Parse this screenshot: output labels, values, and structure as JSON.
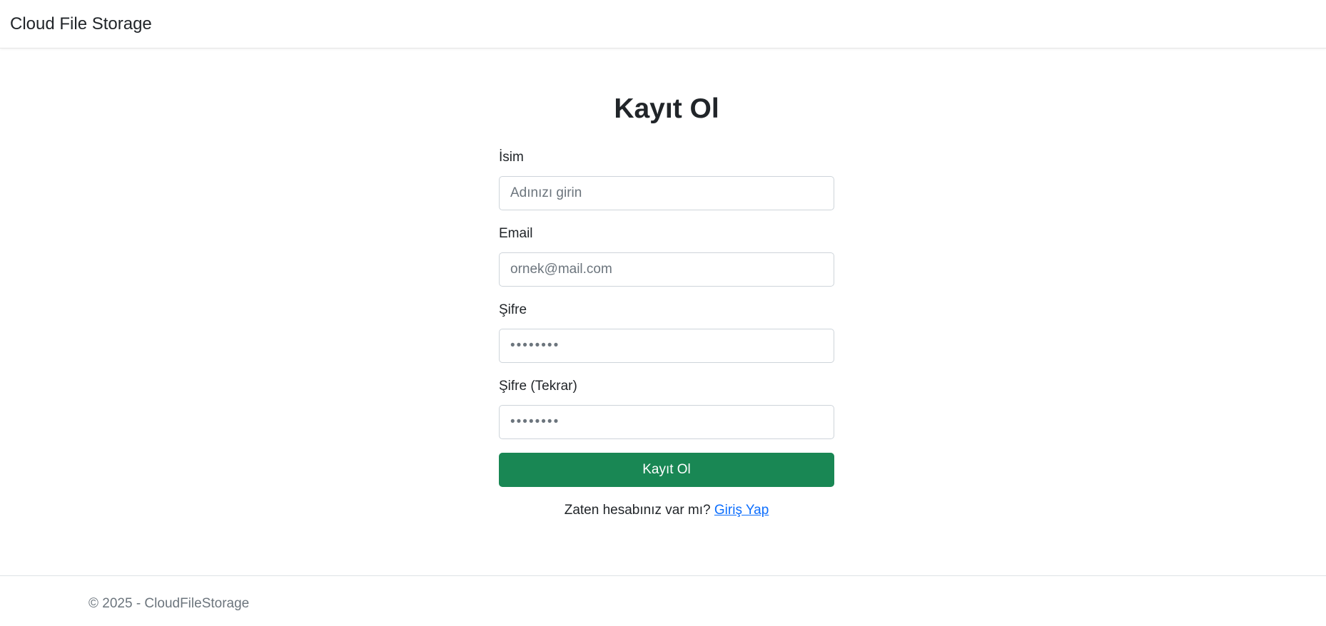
{
  "navbar": {
    "brand": "Cloud File Storage"
  },
  "form": {
    "title": "Kayıt Ol",
    "name": {
      "label": "İsim",
      "placeholder": "Adınızı girin"
    },
    "email": {
      "label": "Email",
      "placeholder": "ornek@mail.com"
    },
    "password": {
      "label": "Şifre",
      "placeholder": "••••••••"
    },
    "password_repeat": {
      "label": "Şifre (Tekrar)",
      "placeholder": "••••••••"
    },
    "submit_label": "Kayıt Ol",
    "login_prompt": "Zaten hesabınız var mı?",
    "login_link": "Giriş Yap"
  },
  "footer": {
    "text": "© 2025 - CloudFileStorage"
  },
  "colors": {
    "primary_button": "#198754",
    "link": "#0d6efd",
    "muted_text": "#6c757d"
  }
}
